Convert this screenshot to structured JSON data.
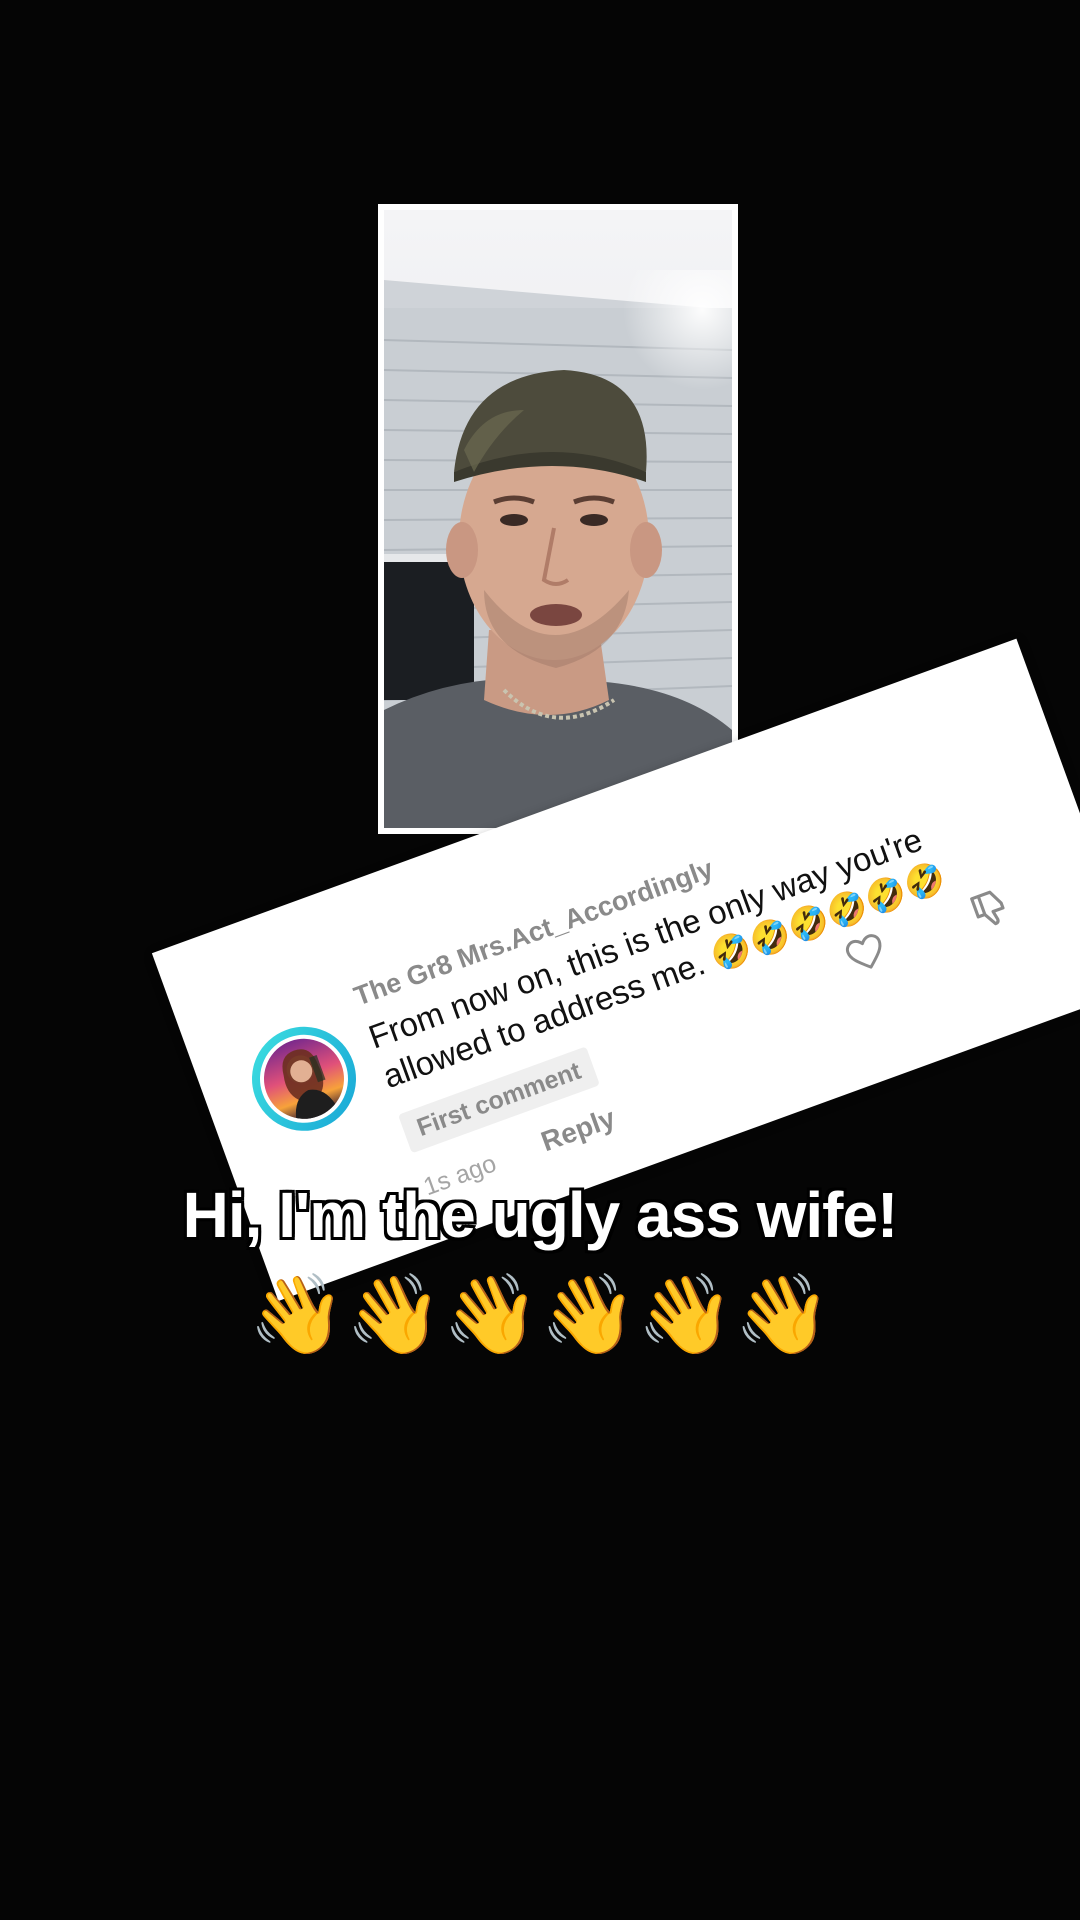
{
  "video": {
    "description_icon": "video-frame"
  },
  "comment": {
    "username": "The Gr8 Mrs.Act_Accordingly",
    "text": "From now on, this is the only way you're allowed to address me. 🤣🤣🤣🤣🤣🤣",
    "badge": "First comment",
    "time": "1s ago",
    "reply_label": "Reply",
    "icons": {
      "like": "heart-icon",
      "dislike": "thumbs-down-icon"
    }
  },
  "caption": {
    "line1": "Hi, I'm the ugly ass wife!",
    "line2": "👋👋👋👋👋👋"
  },
  "colors": {
    "background": "#050505",
    "card": "#ffffff",
    "avatar_ring": "#3ee0e0",
    "muted_text": "#8a8a8a"
  }
}
